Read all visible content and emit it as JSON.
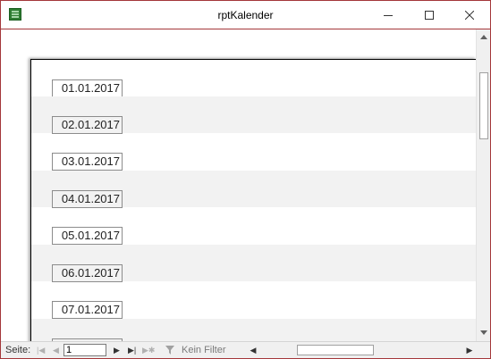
{
  "window": {
    "title": "rptKalender"
  },
  "report": {
    "dates": [
      "01.01.2017",
      "02.01.2017",
      "03.01.2017",
      "04.01.2017",
      "05.01.2017",
      "06.01.2017",
      "07.01.2017"
    ]
  },
  "statusbar": {
    "page_label": "Seite:",
    "page_value": "1",
    "filter_label": "Kein Filter"
  },
  "colors": {
    "window_border": "#a4373a",
    "alt_row": "#f2f2f2",
    "chrome_gray": "#f0f0f0"
  },
  "icons": {
    "app": "access-report-icon",
    "minimize": "minimize-icon",
    "maximize": "maximize-icon",
    "close": "close-icon",
    "filter": "filter-icon"
  }
}
